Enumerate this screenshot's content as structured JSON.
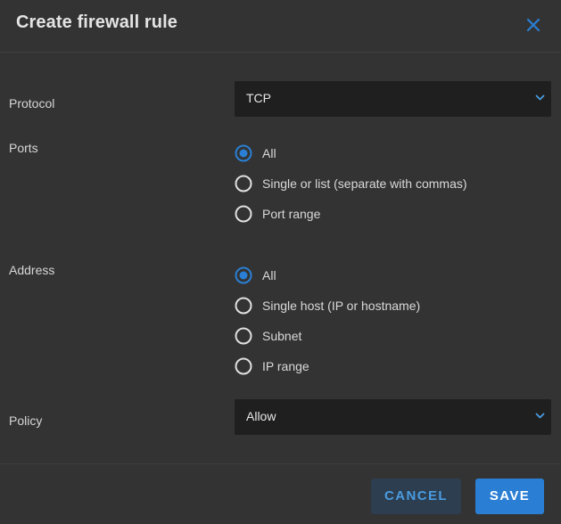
{
  "dialog": {
    "title": "Create firewall rule"
  },
  "protocol": {
    "label": "Protocol",
    "value": "TCP"
  },
  "ports": {
    "label": "Ports",
    "options": [
      {
        "label": "All",
        "selected": true
      },
      {
        "label": "Single or list (separate with commas)",
        "selected": false
      },
      {
        "label": "Port range",
        "selected": false
      }
    ]
  },
  "address": {
    "label": "Address",
    "options": [
      {
        "label": "All",
        "selected": true
      },
      {
        "label": "Single host (IP or hostname)",
        "selected": false
      },
      {
        "label": "Subnet",
        "selected": false
      },
      {
        "label": "IP range",
        "selected": false
      }
    ]
  },
  "policy": {
    "label": "Policy",
    "value": "Allow"
  },
  "footer": {
    "cancel_label": "CANCEL",
    "save_label": "SAVE"
  },
  "colors": {
    "accent": "#2a7fd4",
    "background": "#333333",
    "input_background": "#1f1f1f"
  },
  "icons": {
    "close": "close-icon",
    "chevron": "chevron-down-icon",
    "radio_on": "radio-selected-icon",
    "radio_off": "radio-unselected-icon"
  }
}
